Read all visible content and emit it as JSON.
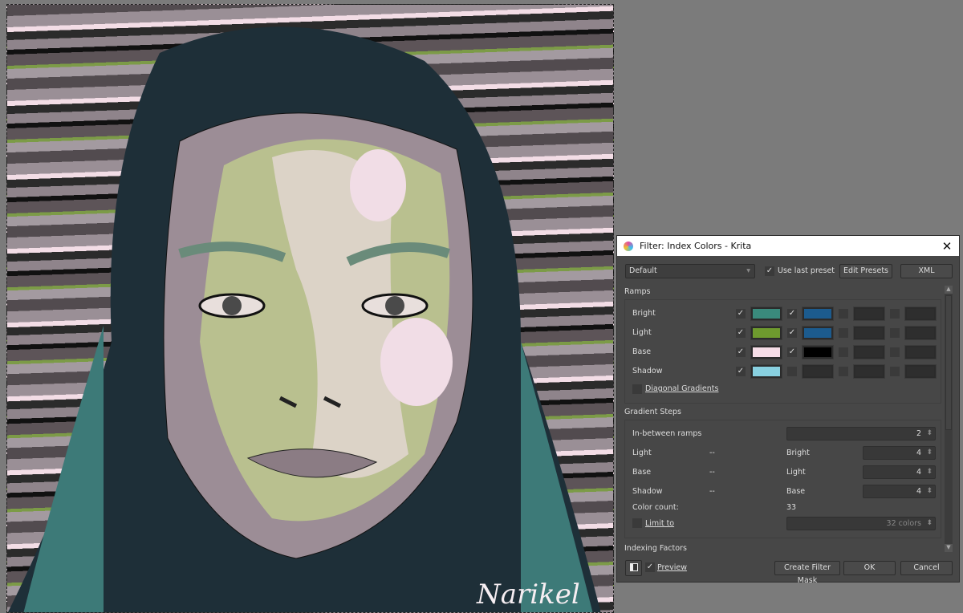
{
  "canvas": {
    "signature": "Narikel"
  },
  "dialog": {
    "title": "Filter: Index Colors - Krita",
    "preset": "Default",
    "use_last_preset": {
      "label": "Use last preset",
      "checked": true
    },
    "edit_presets": "Edit Presets",
    "xml": "XML",
    "ramps": {
      "label": "Ramps",
      "rows": [
        {
          "name": "Bright",
          "slots": [
            {
              "on": true,
              "color": "#3a8a7c"
            },
            {
              "on": true,
              "color": "#1c5b8e"
            },
            {
              "on": false,
              "color": "#2e2e2e"
            },
            {
              "on": false,
              "color": "#2e2e2e"
            }
          ]
        },
        {
          "name": "Light",
          "slots": [
            {
              "on": true,
              "color": "#6e9a2e"
            },
            {
              "on": true,
              "color": "#1c5b8e"
            },
            {
              "on": false,
              "color": "#2e2e2e"
            },
            {
              "on": false,
              "color": "#2e2e2e"
            }
          ]
        },
        {
          "name": "Base",
          "slots": [
            {
              "on": true,
              "color": "#f6dde7"
            },
            {
              "on": true,
              "color": "#000000"
            },
            {
              "on": false,
              "color": "#2e2e2e"
            },
            {
              "on": false,
              "color": "#2e2e2e"
            }
          ]
        },
        {
          "name": "Shadow",
          "slots": [
            {
              "on": true,
              "color": "#88d0e0"
            },
            {
              "on": false,
              "color": "#2e2e2e"
            },
            {
              "on": false,
              "color": "#2e2e2e"
            },
            {
              "on": false,
              "color": "#2e2e2e"
            }
          ]
        }
      ],
      "diagonal": {
        "label": "Diagonal Gradients",
        "checked": false
      }
    },
    "gradient_steps": {
      "label": "Gradient Steps",
      "in_between_label": "In-between ramps",
      "in_between": "2",
      "pairs": [
        {
          "a": "Light",
          "sep": "--",
          "b": "Bright",
          "value": "4"
        },
        {
          "a": "Base",
          "sep": "--",
          "b": "Light",
          "value": "4"
        },
        {
          "a": "Shadow",
          "sep": "--",
          "b": "Base",
          "value": "4"
        }
      ],
      "color_count_label": "Color count:",
      "color_count": "33",
      "limit_label": "Limit to",
      "limit_checked": false,
      "limit_value": "32 colors"
    },
    "indexing_factors": "Indexing Factors",
    "preview": {
      "label": "Preview",
      "checked": true
    },
    "create_mask": "Create Filter Mask",
    "ok": "OK",
    "cancel": "Cancel"
  }
}
